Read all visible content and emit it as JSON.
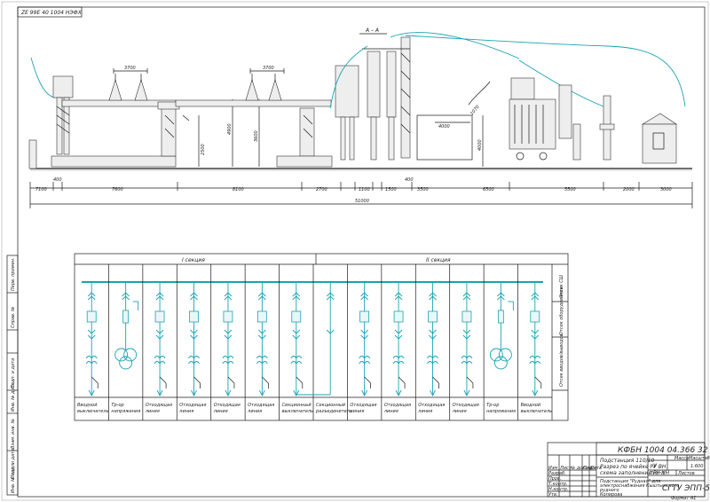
{
  "stamp_top": "ZE 99E 40 1004 НЭФХ",
  "section_mark": "А – А",
  "dims_top": {
    "a": "3700",
    "b": "3700",
    "inclined": "1070"
  },
  "dims_vertical": {
    "a": "4900",
    "b": "3600",
    "c": "2500",
    "d": "4000",
    "e": "4000"
  },
  "dims_bottom": [
    "400",
    "7100",
    "7600",
    "8100",
    "2700",
    "1100",
    "1500",
    "400",
    "3500",
    "6500",
    "5500",
    "2000",
    "3000"
  ],
  "dim_total": "51000",
  "sections": {
    "one": "I секция",
    "two": "II секция"
  },
  "row_labels": {
    "bus": "Отсек СШ",
    "equipment": "Отсек оборудования",
    "cables": "Отсек вводов/выводов"
  },
  "cells": [
    "Вводной выключатель",
    "Тр-ор напряжения",
    "Отходящая линия",
    "Отходящая линия",
    "Отходящая линия",
    "Отходящая линия",
    "Секционный выключатель",
    "Секционный разъединитель",
    "Отходящая линия",
    "Отходящая линия",
    "Отходящая линия",
    "Отходящая линия",
    "Тр-ор напряжения",
    "Вводной выключатель"
  ],
  "title_block": {
    "code": "КФБН 1004 04.366 32",
    "name_l1": "Подстанция 110/10",
    "name_l2": "Разрез по ячейке РУ ВН",
    "name_l3": "схема заполнения РУ НН",
    "sub_l1": "Подстанция \"Рудная\" для",
    "sub_l2": "электроснабжения Кыштымского",
    "sub_l3": "рудного",
    "sub_l4": "Копирова",
    "org": "СГТУ ЭПП-52",
    "scale": "1:600",
    "lit": "У",
    "sheet_label": "Лист",
    "sheets_label": "Листов",
    "sheet_num": "1",
    "format": "Формат А1",
    "mass_label": "Масса",
    "scale_label": "Масштаб",
    "rows": [
      "Изм",
      "Лист",
      "№ докум.",
      "Подп.",
      "Дата"
    ],
    "left_roles": [
      "Разраб.",
      "Пров.",
      "Т.контр.",
      "Н.контр.",
      "Утв."
    ]
  },
  "side_stamp": [
    "Перв. примен.",
    "Справ. №",
    "Подп. и дата",
    "Инв. № дубл.",
    "Взам. инв. №",
    "Подп. и дата",
    "Инв. № подл."
  ]
}
